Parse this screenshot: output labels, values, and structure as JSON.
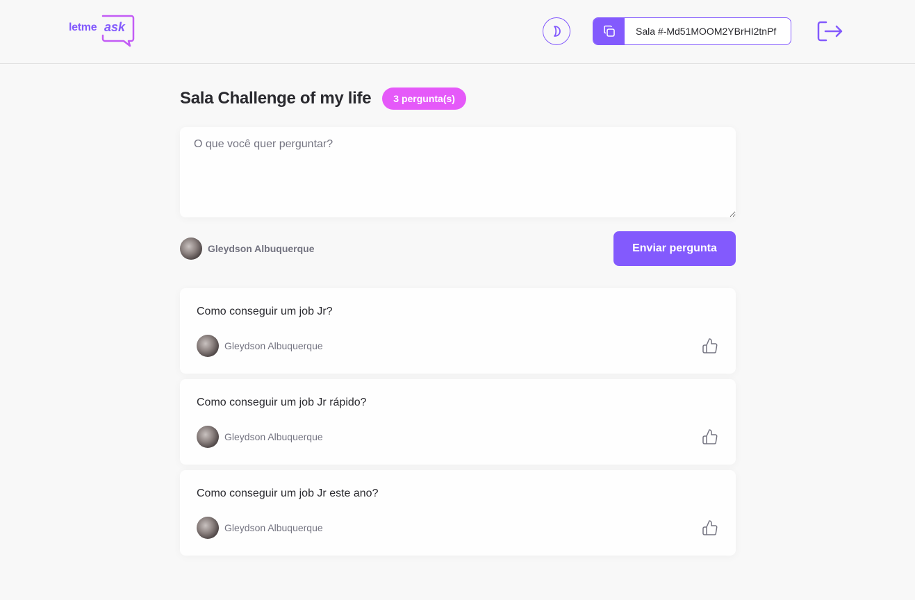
{
  "header": {
    "logo": {
      "word_main": "letme",
      "word_accent": "ask"
    },
    "theme_toggle_icon": "moon-icon",
    "room_code": {
      "label": "Sala #-Md51MOOM2YBrHI2tnPf",
      "icon": "copy-icon"
    },
    "logout_icon": "log-out-icon"
  },
  "room": {
    "title": "Sala Challenge of my life",
    "question_count_badge": "3 pergunta(s)"
  },
  "form": {
    "placeholder": "O que você quer perguntar?",
    "user_name": "Gleydson Albuquerque",
    "submit_label": "Enviar pergunta"
  },
  "questions": [
    {
      "content": "Como conseguir um job Jr?",
      "author": "Gleydson Albuquerque",
      "like_icon": "thumbs-up-icon"
    },
    {
      "content": "Como conseguir um job Jr rápido?",
      "author": "Gleydson Albuquerque",
      "like_icon": "thumbs-up-icon"
    },
    {
      "content": "Como conseguir um job Jr este ano?",
      "author": "Gleydson Albuquerque",
      "like_icon": "thumbs-up-icon"
    }
  ],
  "colors": {
    "primary": "#835afd",
    "badge": "#e559f9",
    "background": "#f8f8f8",
    "text": "#29292e",
    "muted": "#737380"
  }
}
